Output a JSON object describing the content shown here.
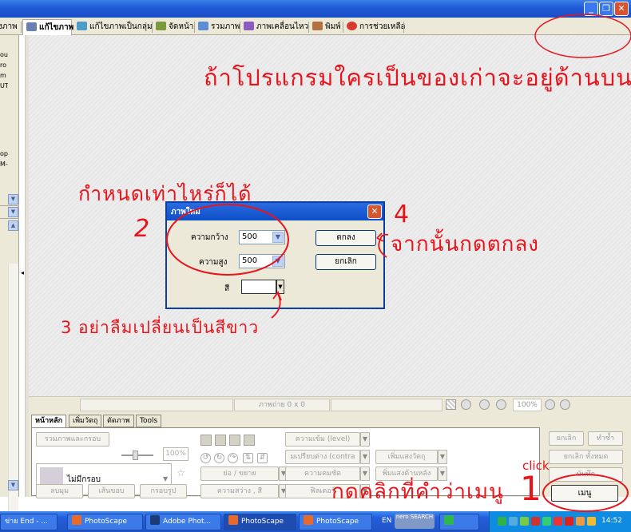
{
  "colors": {
    "annotation": "#e8141c",
    "titlebar": "#1f5ad8",
    "taskbar": "#245edb"
  },
  "window_controls": {
    "minimize": "_",
    "maximize": "❐",
    "close": "✕"
  },
  "tabs": [
    {
      "label": "งภาพ",
      "icon": "photo-icon",
      "active": false
    },
    {
      "label": "แก้ไขภาพ",
      "icon": "edit-icon",
      "active": true
    },
    {
      "label": "แก้ไขภาพเป็นกลุ่ม",
      "icon": "batch-icon",
      "active": false
    },
    {
      "label": "จัดหน้า",
      "icon": "page-icon",
      "active": false
    },
    {
      "label": "รวมภาพ",
      "icon": "combine-icon",
      "active": false
    },
    {
      "label": "ภาพเคลื่อนไหว",
      "icon": "animation-icon",
      "active": false
    },
    {
      "label": "พิมพ์",
      "icon": "print-icon",
      "active": false
    },
    {
      "label": "การช่วยเหลือ",
      "icon": "help-icon",
      "active": false
    }
  ],
  "left_panel": {
    "text": [
      "ou",
      "ro",
      "m",
      "UT",
      "op",
      "M-"
    ]
  },
  "statusbar": {
    "photo_info": "ภาพถ่าย 0 x 0",
    "zoom": "100%"
  },
  "panel_tabs": [
    "หน้าหลัก",
    "เพิ่มวัตถุ",
    "ตัดภาพ",
    "Tools"
  ],
  "panel": {
    "frame_button": "รวมภาพและกรอบ",
    "frame_pct": "100%",
    "frame_name": "ไม่มีกรอบ",
    "round": "ลบมุม",
    "border": "เส้นขอบ",
    "frame_line": "กรอบรูป",
    "resize": "ย่อ / ขยาย",
    "brightness": "ความสว่าง , สี",
    "level": "ความเข้ม (level)",
    "contrast": "มเปรียบต่าง (contra",
    "sharpen": "ความคมชัด",
    "filter": "ฟิลเตอร์",
    "add_object": "เพิ่มแสงวัตถุ",
    "backlight": "พิ่มแสงด้านหลัง"
  },
  "right_buttons": {
    "undo": "ยกเลิก",
    "redo": "ทำซ้ำ",
    "undo_all": "ยกเลิก ทั้งหมด",
    "save": "บันทึก",
    "menu": "เมนู"
  },
  "dialog": {
    "title": "ภาพใหม่",
    "width_label": "ความกว้าง",
    "width_value": "500",
    "height_label": "ความสูง",
    "height_value": "500",
    "color_label": "สี",
    "ok": "ตกลง",
    "cancel": "ยกเลิก"
  },
  "annotations": {
    "top": "ถ้าโปรแกรมใครเป็นของเก่าจะอยู่ด้านบน",
    "any_size": "กำหนดเท่าไหร่ก็ได้",
    "step2": "2",
    "step3": "3 อย่าลืมเปลี่ยนเป็นสีขาว",
    "step4": "4",
    "then_ok": "จากนั้นกดตกลง",
    "click_menu": "กดคลิกที่คำว่าเมนู",
    "step1": "1",
    "click": "click"
  },
  "taskbar": {
    "items": [
      "ข่าย End - ...",
      "PhotoScape",
      "Adobe Phot...",
      "PhotoScape",
      "PhotoScape",
      ""
    ],
    "lang": "EN",
    "nero": "nero SEARCH",
    "clock": "14:52"
  }
}
